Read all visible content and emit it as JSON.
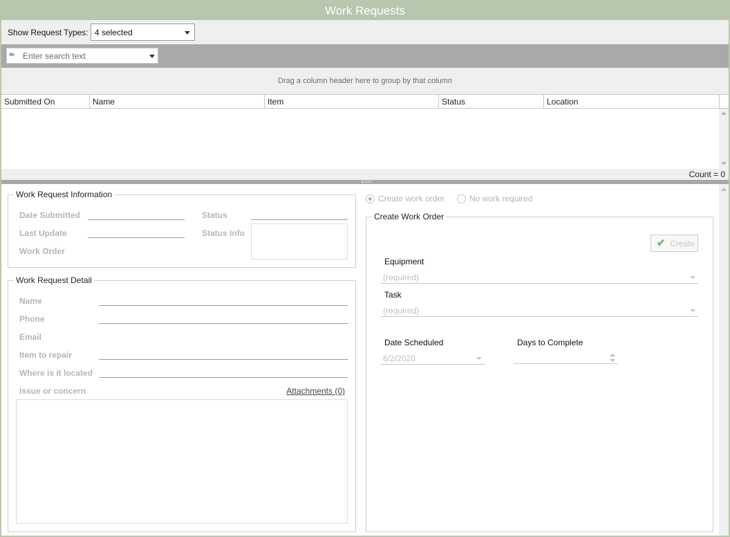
{
  "title": "Work Requests",
  "filter": {
    "label": "Show Request Types:",
    "selected": "4 selected"
  },
  "search": {
    "placeholder": "Enter search text",
    "icon": "abc-search-icon"
  },
  "grid": {
    "group_hint": "Drag a column header here to group by that column",
    "columns": [
      "Submitted On",
      "Name",
      "Item",
      "Status",
      "Location"
    ],
    "rows": [],
    "count_text": "Count = 0"
  },
  "info": {
    "legend": "Work Request Information",
    "date_submitted": "Date Submitted",
    "last_update": "Last Update",
    "work_order": "Work Order",
    "status": "Status",
    "status_info": "Status Info"
  },
  "detail": {
    "legend": "Work Request Detail",
    "name": "Name",
    "phone": "Phone",
    "email": "Email",
    "item_to_repair": "Item to repair",
    "where_located": "Where is it located",
    "issue": "Issue or concern",
    "attachments": "Attachments (0)"
  },
  "options": {
    "create_work_order": "Create work order",
    "no_work_required": "No work required",
    "selected": "create_work_order"
  },
  "work_order": {
    "legend": "Create Work Order",
    "create_button": "Create",
    "equipment_label": "Equipment",
    "equipment_placeholder": "(required)",
    "task_label": "Task",
    "task_placeholder": "(required)",
    "date_scheduled_label": "Date Scheduled",
    "date_scheduled_value": "6/2/2020",
    "days_to_complete_label": "Days to Complete",
    "days_to_complete_value": ""
  },
  "colors": {
    "title_bar": "#b7c7ae",
    "frame_border": "#b9c7ae",
    "toolbar_bg": "#efefef",
    "search_bar_bg": "#a9a9a9",
    "check_green": "#6cb47a"
  }
}
